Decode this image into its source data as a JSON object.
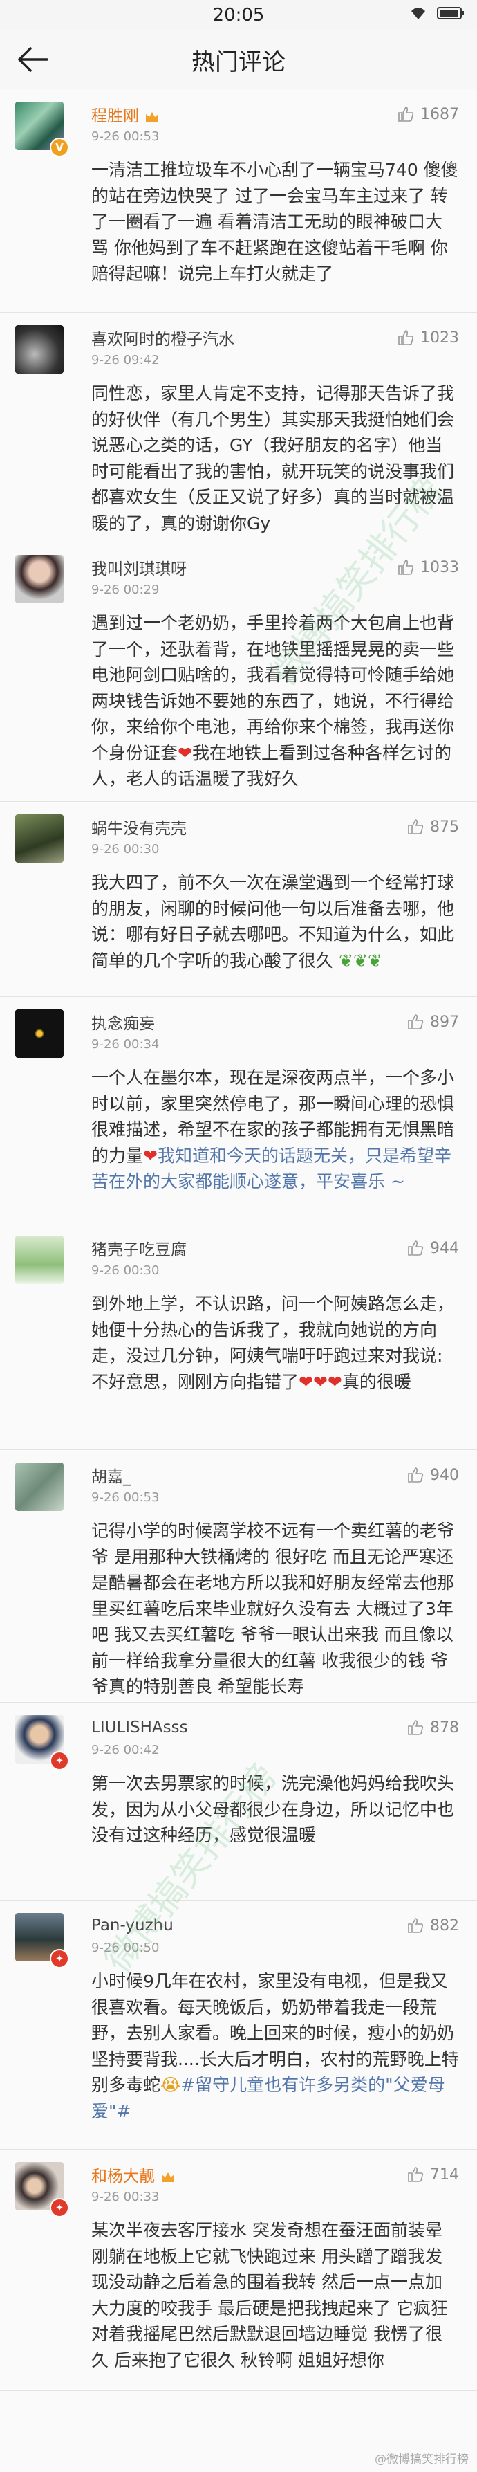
{
  "status_bar": {
    "time": "20:05"
  },
  "nav": {
    "title": "热门评论"
  },
  "comments": [
    {
      "name": "程胜刚",
      "time": "9-26 00:53",
      "likes": "1687",
      "text": "一清洁工推垃圾车不小心刮了一辆宝马740 傻傻的站在旁边快哭了 过了一会宝马车主过来了 转了一圈看了一遍 看着清洁工无助的眼神破口大骂 你他妈到了车不赶紧跑在这傻站着干毛啊 你赔得起嘛！说完上车打火就走了"
    },
    {
      "name": "喜欢阿时的橙子汽水",
      "time": "9-26 09:42",
      "likes": "1023",
      "text": "同性恋，家里人肯定不支持，记得那天告诉了我的好伙伴（有几个男生）其实那天我挺怕她们会说恶心之类的话，GY（我好朋友的名字）他当时可能看出了我的害怕，就开玩笑的说没事我们都喜欢女生（反正又说了好多）真的当时就被温暖的了，真的谢谢你Gy"
    },
    {
      "name": "我叫刘琪琪呀",
      "time": "9-26 00:29",
      "likes": "1033",
      "text": "遇到过一个老奶奶，手里拎着两个大包肩上也背了一个，还驮着背，在地铁里摇摇晃晃的卖一些电池阿剑口贴啥的，我看着觉得特可怜随手给她两块钱告诉她不要她的东西了，她说，不行得给你，来给你个电池，再给你来个棉签，我再送你个身份证套",
      "text_tail": "我在地铁上看到过各种各样乞讨的人，老人的话温暖了我好久"
    },
    {
      "name": "蜗牛没有壳壳",
      "time": "9-26 00:30",
      "likes": "875",
      "text": "我大四了，前不久一次在澡堂遇到一个经常打球的朋友，闲聊的时候问他一句以后准备去哪，他说：哪有好日子就去哪吧。不知道为什么，如此简单的几个字听的我心酸了很久"
    },
    {
      "name": "执念痴妄",
      "time": "9-26 00:34",
      "likes": "897",
      "text": "一个人在墨尔本，现在是深夜两点半，一个多小时以前，家里突然停电了，那一瞬间心理的恐惧很难描述，希望不在家的孩子都能拥有无惧黑暗的力量",
      "text_tail": "我知道和今天的话题无关，只是希望辛苦在外的大家都能顺心遂意，平安喜乐 ~"
    },
    {
      "name": "猪壳子吃豆腐",
      "time": "9-26 00:30",
      "likes": "944",
      "text": "到外地上学，不认识路，问一个阿姨路怎么走，她便十分热心的告诉我了，我就向她说的方向走，没过几分钟，阿姨气喘吁吁跑过来对我说:不好意思，刚刚方向指错了",
      "text_tail": "真的很暖"
    },
    {
      "name": "胡嘉_",
      "time": "9-26 00:53",
      "likes": "940",
      "text": "记得小学的时候离学校不远有一个卖红薯的老爷爷 是用那种大铁桶烤的 很好吃 而且无论严寒还是酷暑都会在老地方所以我和好朋友经常去他那里买红薯吃后来毕业就好久没有去 大概过了3年吧 我又去买红薯吃 爷爷一眼认出来我 而且像以前一样给我拿分量很大的红薯 收我很少的钱 爷爷真的特别善良 希望能长寿"
    },
    {
      "name": "LIULISHAsss",
      "time": "9-26 00:42",
      "likes": "878",
      "text": "第一次去男票家的时候，洗完澡他妈妈给我吹头发，因为从小父母都很少在身边，所以记忆中也没有过这种经历，感觉很温暖"
    },
    {
      "name": "Pan-yuzhu",
      "time": "9-26 00:50",
      "likes": "882",
      "text": "小时候9几年在农村，家里没有电视，但是我又很喜欢看。每天晚饭后，奶奶带着我走一段荒野，去别人家看。晚上回来的时候，瘦小的奶奶坚持要背我....长大后才明白，农村的荒野晚上特别多毒蛇",
      "text_tail": "#留守儿童也有许多另类的\"父爱母爱\"#"
    },
    {
      "name": "和杨大靓",
      "time": "9-26 00:33",
      "likes": "714",
      "text": "某次半夜去客厅接水 突发奇想在蚕汪面前装晕 刚躺在地板上它就飞快跑过来 用头蹭了蹭我发现没动静之后着急的围着我转 然后一点一点加大力度的咬我手 最后硬是把我拽起来了 它疯狂对着我摇尾巴然后默默退回墙边睡觉 我愣了很久 后来抱了它很久 秋铃啊 姐姐好想你"
    }
  ],
  "watermark": {
    "text": "微博搞笑排行榜",
    "footer": "@微博搞笑排行榜"
  }
}
